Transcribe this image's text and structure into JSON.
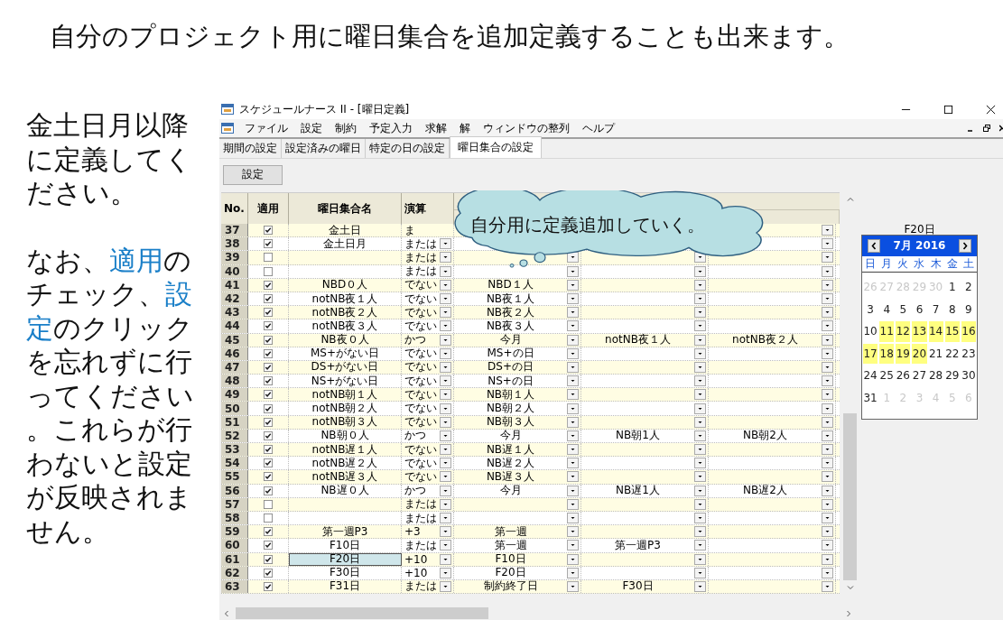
{
  "heading": "自分のプロジェクト用に曜日集合を追加定義することも出来ます。",
  "note": [
    [
      {
        "text": "金土日月以降に定義してください。",
        "blue": false
      }
    ],
    [
      {
        "text": "なお、",
        "blue": false
      },
      {
        "text": "適用",
        "blue": true
      },
      {
        "text": "のチェック、",
        "blue": false
      },
      {
        "text": "設定",
        "blue": true
      },
      {
        "text": "のクリックを忘れずに行ってください。これらが行わないと設定が反映されません。",
        "blue": false
      }
    ]
  ],
  "window": {
    "title": "スケジュールナース II - [曜日定義]"
  },
  "menu": [
    "ファイル",
    "設定",
    "制約",
    "予定入力",
    "求解",
    "解",
    "ウィンドウの整列",
    "ヘルプ"
  ],
  "tabs": [
    {
      "label": "期間の設定",
      "selected": false
    },
    {
      "label": "設定済みの曜日",
      "selected": false
    },
    {
      "label": "特定の日の設定",
      "selected": false
    },
    {
      "label": "曜日集合の設定",
      "selected": true
    }
  ],
  "apply_button": "設定",
  "columns": [
    "No.",
    "適用",
    "曜日集合名",
    "演算"
  ],
  "rows": [
    {
      "no": "37",
      "checked": true,
      "name": "金土日",
      "op": "ま",
      "selected": false
    },
    {
      "no": "38",
      "checked": true,
      "name": "金土日月",
      "op": "または",
      "selected": false
    },
    {
      "no": "39",
      "checked": false,
      "op": "または",
      "selected": false
    },
    {
      "no": "40",
      "checked": false,
      "op": "または",
      "selected": false
    },
    {
      "no": "41",
      "checked": true,
      "name": "NBD０人",
      "op": "でない",
      "c5": "NBD１人",
      "selected": false
    },
    {
      "no": "42",
      "checked": true,
      "name": "notNB夜１人",
      "op": "でない",
      "c5": "NB夜１人",
      "selected": false
    },
    {
      "no": "43",
      "checked": true,
      "name": "notNB夜２人",
      "op": "でない",
      "c5": "NB夜２人",
      "selected": false
    },
    {
      "no": "44",
      "checked": true,
      "name": "notNB夜３人",
      "op": "でない",
      "c5": "NB夜３人",
      "selected": false
    },
    {
      "no": "45",
      "checked": true,
      "name": "NB夜０人",
      "op": "かつ",
      "c5": "今月",
      "c6": "notNB夜１人",
      "c7": "notNB夜２人",
      "selected": false
    },
    {
      "no": "46",
      "checked": true,
      "name": "MS+がない日",
      "op": "でない",
      "c5": "MS+の日",
      "selected": false
    },
    {
      "no": "47",
      "checked": true,
      "name": "DS+がない日",
      "op": "でない",
      "c5": "DS+の日",
      "selected": false
    },
    {
      "no": "48",
      "checked": true,
      "name": "NS+がない日",
      "op": "でない",
      "c5": "NS+の日",
      "selected": false
    },
    {
      "no": "49",
      "checked": true,
      "name": "notNB朝１人",
      "op": "でない",
      "c5": "NB朝１人",
      "selected": false
    },
    {
      "no": "50",
      "checked": true,
      "name": "notNB朝２人",
      "op": "でない",
      "c5": "NB朝２人",
      "selected": false
    },
    {
      "no": "51",
      "checked": true,
      "name": "notNB朝３人",
      "op": "でない",
      "c5": "NB朝３人",
      "selected": false
    },
    {
      "no": "52",
      "checked": true,
      "name": "NB朝０人",
      "op": "かつ",
      "c5": "今月",
      "c6": "NB朝1人",
      "c7": "NB朝2人",
      "selected": false
    },
    {
      "no": "53",
      "checked": true,
      "name": "notNB遅１人",
      "op": "でない",
      "c5": "NB遅１人",
      "selected": false
    },
    {
      "no": "54",
      "checked": true,
      "name": "notNB遅２人",
      "op": "でない",
      "c5": "NB遅２人",
      "selected": false
    },
    {
      "no": "55",
      "checked": true,
      "name": "notNB遅３人",
      "op": "でない",
      "c5": "NB遅３人",
      "selected": false
    },
    {
      "no": "56",
      "checked": true,
      "name": "NB遅０人",
      "op": "かつ",
      "c5": "今月",
      "c6": "NB遅1人",
      "c7": "NB遅2人",
      "selected": false
    },
    {
      "no": "57",
      "checked": false,
      "op": "または",
      "selected": false
    },
    {
      "no": "58",
      "checked": false,
      "op": "または",
      "selected": false
    },
    {
      "no": "59",
      "checked": true,
      "name": "第一週P3",
      "op": "+3",
      "c5": "第一週",
      "selected": false
    },
    {
      "no": "60",
      "checked": true,
      "name": "F10日",
      "op": "または",
      "c5": "第一週",
      "c6": "第一週P3",
      "selected": false
    },
    {
      "no": "61",
      "checked": true,
      "name": "F20日",
      "op": "+10",
      "c5": "F10日",
      "selected": true
    },
    {
      "no": "62",
      "checked": true,
      "name": "F30日",
      "op": "+10",
      "c5": "F20日",
      "selected": false
    },
    {
      "no": "63",
      "checked": true,
      "name": "F31日",
      "op": "または",
      "c5": "制約終了日",
      "c6": "F30日",
      "selected": false
    }
  ],
  "callout": "自分用に定義追加していく。",
  "calendar": {
    "label": "F20日",
    "month": "7月 2016",
    "weekdays": [
      "日",
      "月",
      "火",
      "水",
      "木",
      "金",
      "土"
    ],
    "weeks": [
      [
        {
          "d": "26",
          "muted": true,
          "highlighted": false
        },
        {
          "d": "27",
          "muted": true,
          "highlighted": false
        },
        {
          "d": "28",
          "muted": true,
          "highlighted": false
        },
        {
          "d": "29",
          "muted": true,
          "highlighted": false
        },
        {
          "d": "30",
          "muted": true,
          "highlighted": false
        },
        {
          "d": "1",
          "muted": false,
          "highlighted": false
        },
        {
          "d": "2",
          "muted": false,
          "highlighted": false
        }
      ],
      [
        {
          "d": "3",
          "muted": false,
          "highlighted": false
        },
        {
          "d": "4",
          "muted": false,
          "highlighted": false
        },
        {
          "d": "5",
          "muted": false,
          "highlighted": false
        },
        {
          "d": "6",
          "muted": false,
          "highlighted": false
        },
        {
          "d": "7",
          "muted": false,
          "highlighted": false
        },
        {
          "d": "8",
          "muted": false,
          "highlighted": false
        },
        {
          "d": "9",
          "muted": false,
          "highlighted": false
        }
      ],
      [
        {
          "d": "10",
          "muted": false,
          "highlighted": false
        },
        {
          "d": "11",
          "muted": false,
          "highlighted": true
        },
        {
          "d": "12",
          "muted": false,
          "highlighted": true
        },
        {
          "d": "13",
          "muted": false,
          "highlighted": true
        },
        {
          "d": "14",
          "muted": false,
          "highlighted": true
        },
        {
          "d": "15",
          "muted": false,
          "highlighted": true
        },
        {
          "d": "16",
          "muted": false,
          "highlighted": true
        }
      ],
      [
        {
          "d": "17",
          "muted": false,
          "highlighted": true
        },
        {
          "d": "18",
          "muted": false,
          "highlighted": true
        },
        {
          "d": "19",
          "muted": false,
          "highlighted": true
        },
        {
          "d": "20",
          "muted": false,
          "highlighted": true
        },
        {
          "d": "21",
          "muted": false,
          "highlighted": false
        },
        {
          "d": "22",
          "muted": false,
          "highlighted": false
        },
        {
          "d": "23",
          "muted": false,
          "highlighted": false
        }
      ],
      [
        {
          "d": "24",
          "muted": false,
          "highlighted": false
        },
        {
          "d": "25",
          "muted": false,
          "highlighted": false
        },
        {
          "d": "26",
          "muted": false,
          "highlighted": false
        },
        {
          "d": "27",
          "muted": false,
          "highlighted": false
        },
        {
          "d": "28",
          "muted": false,
          "highlighted": false
        },
        {
          "d": "29",
          "muted": false,
          "highlighted": false
        },
        {
          "d": "30",
          "muted": false,
          "highlighted": false
        }
      ],
      [
        {
          "d": "31",
          "muted": false,
          "highlighted": false
        },
        {
          "d": "1",
          "muted": true,
          "highlighted": false
        },
        {
          "d": "2",
          "muted": true,
          "highlighted": false
        },
        {
          "d": "3",
          "muted": true,
          "highlighted": false
        },
        {
          "d": "4",
          "muted": true,
          "highlighted": false
        },
        {
          "d": "5",
          "muted": true,
          "highlighted": false
        },
        {
          "d": "6",
          "muted": true,
          "highlighted": false
        }
      ]
    ]
  }
}
